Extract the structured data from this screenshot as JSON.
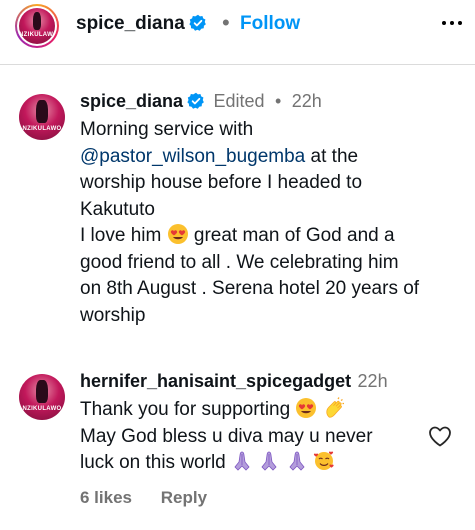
{
  "header": {
    "username": "spice_diana",
    "follow_label": "Follow",
    "avatar_text": "NZIKULAWO"
  },
  "caption": {
    "username": "spice_diana",
    "edited": "Edited",
    "time": "22h",
    "line1": "Morning service with",
    "mention": "@pastor_wilson_bugemba",
    "line2_rest": " at the",
    "line3": "worship house before I headed to",
    "line4": "Kakututo",
    "line5_a": "I love him ",
    "line5_b": " great man of God and a",
    "line6": "good friend to all . We celebrating him",
    "line7": "on 8th August . Serena hotel 20 years of",
    "line8": "worship",
    "avatar_text": "NZIKULAWO"
  },
  "comment": {
    "username": "hernifer_hanisaint_spicegadget",
    "time": "22h",
    "line1": "Thank you for supporting ",
    "line2": "May God bless u diva may u never",
    "line3": "luck on this world ",
    "likes": "6 likes",
    "reply_label": "Reply",
    "avatar_text": "NZIKULAWO"
  },
  "icons": [
    "verified-badge-icon",
    "more-options-icon",
    "heart-eyes-emoji",
    "clapping-emoji",
    "praying-hands-emoji",
    "hearts-face-emoji",
    "heart-outline-icon"
  ],
  "colors": {
    "accent": "#0095f6",
    "mention": "#00376b",
    "muted": "#737373",
    "verified": "#0095f6"
  }
}
